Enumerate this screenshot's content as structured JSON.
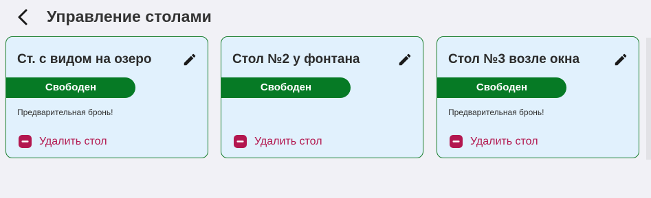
{
  "header": {
    "title": "Управление столами"
  },
  "cards": [
    {
      "title": "Ст. с видом на озеро",
      "status": "Свободен",
      "note": "Предварительная бронь!",
      "delete_label": "Удалить стол"
    },
    {
      "title": "Стол №2 у фонтана",
      "status": "Свободен",
      "note": "",
      "delete_label": "Удалить стол"
    },
    {
      "title": "Стол №3 возле окна",
      "status": "Свободен",
      "note": "Предварительная бронь!",
      "delete_label": "Удалить стол"
    }
  ],
  "colors": {
    "status_free": "#067a25",
    "card_border": "#177d2c",
    "card_background": "#e1f1fd",
    "delete": "#b3174f"
  },
  "icons": {
    "back": "chevron-left-icon",
    "edit": "pencil-icon",
    "delete": "minus-circle-icon"
  }
}
